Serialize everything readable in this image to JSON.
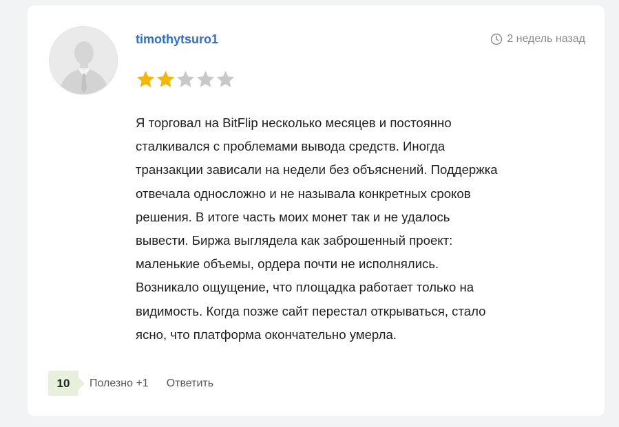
{
  "review": {
    "username": "timothytsuro1",
    "timestamp": "2 недель назад",
    "rating": 2,
    "rating_max": 5,
    "text": "Я торговал на BitFlip несколько месяцев и постоянно\nсталкивался с проблемами вывода средств. Иногда\nтранзакции зависали на недели без объяснений. Поддержка\nотвечала односложно и не называла конкретных сроков\nрешения. В итоге часть моих монет так и не удалось\nвывести. Биржа выглядела как заброшенный проект:\nмаленькие объемы, ордера почти не исполнялись.\nВозникало ощущение, что площадка работает только на\nвидимость. Когда позже сайт перестал открываться, стало\nясно, что платформа окончательно умерла."
  },
  "footer": {
    "vote_count": "10",
    "helpful_label": "Полезно +1",
    "reply_label": "Ответить"
  },
  "icons": {
    "avatar": "user-silhouette-icon",
    "clock": "clock-icon",
    "star": "star-icon"
  },
  "colors": {
    "username": "#2d6fd6",
    "star_filled": "#f5b800",
    "star_empty": "#c8c8c8",
    "vote_badge": "#e6f0dc"
  }
}
